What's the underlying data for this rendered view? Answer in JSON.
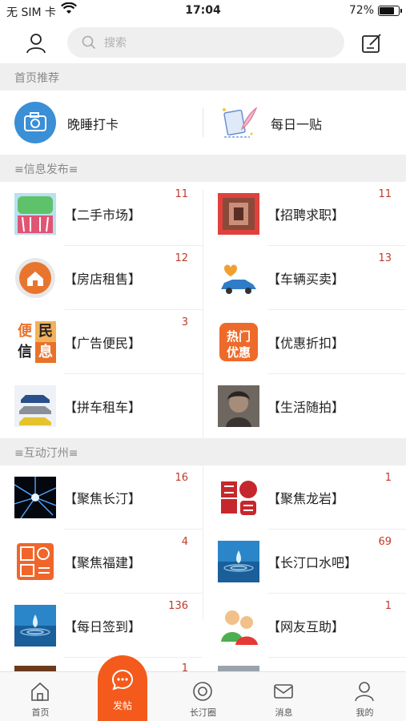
{
  "status_bar": {
    "carrier": "无 SIM 卡",
    "time": "17:04",
    "battery": "72%",
    "battery_level": 0.72
  },
  "header": {
    "search_placeholder": "搜索",
    "user_icon": "user-icon",
    "edit_icon": "edit-icon"
  },
  "sections": {
    "recommend": "首页推荐",
    "info": "≡信息发布≡",
    "interact": "≡互动汀州≡"
  },
  "recommend": [
    {
      "label": "晚睡打卡",
      "icon": "camera-icon"
    },
    {
      "label": "每日一贴",
      "icon": "quill-paper-icon"
    }
  ],
  "info_items": [
    {
      "title": "【二手市场】",
      "count": "11",
      "thumb": "basket-thumb"
    },
    {
      "title": "【招聘求职】",
      "count": "11",
      "thumb": "recruit-thumb"
    },
    {
      "title": "【房店租售】",
      "count": "12",
      "thumb": "house-thumb"
    },
    {
      "title": "【车辆买卖】",
      "count": "13",
      "thumb": "car-thumb"
    },
    {
      "title": "【广告便民】",
      "count": "3",
      "thumb": "ad-thumb",
      "thumb_text": [
        "便",
        "民",
        "信",
        "息"
      ]
    },
    {
      "title": "【优惠折扣】",
      "count": "",
      "thumb": "discount-thumb",
      "thumb_text": [
        "热门",
        "优惠"
      ]
    },
    {
      "title": "【拼车租车】",
      "count": "",
      "thumb": "carpool-thumb"
    },
    {
      "title": "【生活随拍】",
      "count": "",
      "thumb": "photo-thumb"
    }
  ],
  "interact_items": [
    {
      "title": "【聚焦长汀】",
      "count": "16",
      "thumb": "starburst-thumb"
    },
    {
      "title": "【聚焦龙岩】",
      "count": "1",
      "thumb": "seal-red-thumb"
    },
    {
      "title": "【聚焦福建】",
      "count": "4",
      "thumb": "seal-orange-thumb"
    },
    {
      "title": "【长汀口水吧】",
      "count": "69",
      "thumb": "water-drop-thumb"
    },
    {
      "title": "【每日签到】",
      "count": "136",
      "thumb": "water-drop-thumb-2"
    },
    {
      "title": "【网友互助】",
      "count": "1",
      "thumb": "people-thumb"
    }
  ],
  "partial_row": {
    "count_left": "1"
  },
  "tabs": [
    {
      "label": "首页",
      "icon": "home-icon"
    },
    {
      "label": "发帖",
      "icon": "chat-bubble-icon"
    },
    {
      "label": "长汀圈",
      "icon": "circle-target-icon"
    },
    {
      "label": "消息",
      "icon": "mail-icon"
    },
    {
      "label": "我的",
      "icon": "profile-icon"
    }
  ],
  "colors": {
    "accent": "#f45a1c",
    "count": "#c0392b",
    "section_bg": "#efefef",
    "camera_blue": "#3a8fd6"
  }
}
